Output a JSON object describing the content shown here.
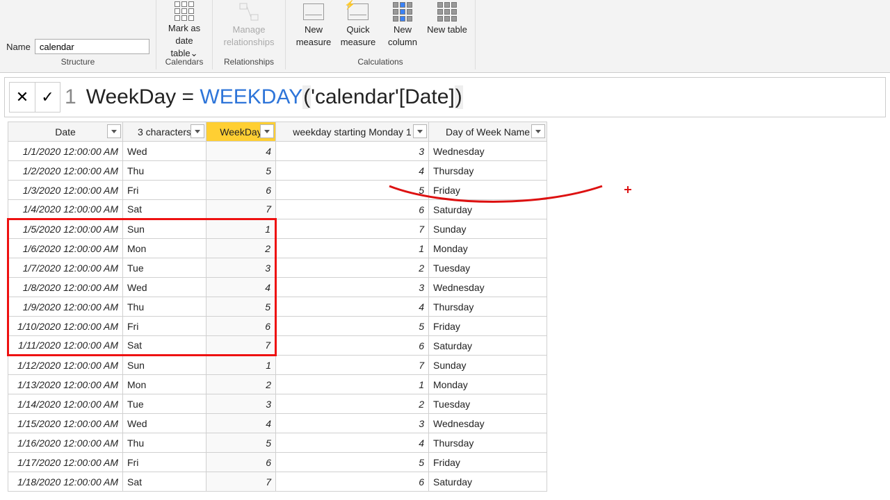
{
  "name_label": "Name",
  "table_name": "calendar",
  "ribbon": {
    "groups": {
      "structure": "Structure",
      "calendars": "Calendars",
      "relationships": "Relationships",
      "calculations": "Calculations"
    },
    "mark_date": "Mark as date table",
    "chev": "⌄",
    "manage_rel": "Manage relationships",
    "new_measure": "New measure",
    "quick_measure": "Quick measure",
    "new_column": "New column",
    "new_table": "New table"
  },
  "formula": {
    "line": "1",
    "lhs": "WeekDay",
    "eq": "=",
    "fn": "WEEKDAY",
    "open": "(",
    "arg": "'calendar'[Date]",
    "close": ")"
  },
  "fx": {
    "cancel": "✕",
    "accept": "✓"
  },
  "headers": {
    "date": "Date",
    "three": "3 characters",
    "weekday": "WeekDay",
    "wsm": "weekday starting Monday 1",
    "down": "Day of Week Name"
  },
  "rows": [
    {
      "date": "1/1/2020 12:00:00 AM",
      "t": "Wed",
      "wd": "4",
      "wsm": "3",
      "down": "Wednesday",
      "hl": ""
    },
    {
      "date": "1/2/2020 12:00:00 AM",
      "t": "Thu",
      "wd": "5",
      "wsm": "4",
      "down": "Thursday",
      "hl": ""
    },
    {
      "date": "1/3/2020 12:00:00 AM",
      "t": "Fri",
      "wd": "6",
      "wsm": "5",
      "down": "Friday",
      "hl": ""
    },
    {
      "date": "1/4/2020 12:00:00 AM",
      "t": "Sat",
      "wd": "7",
      "wsm": "6",
      "down": "Saturday",
      "hl": ""
    },
    {
      "date": "1/5/2020 12:00:00 AM",
      "t": "Sun",
      "wd": "1",
      "wsm": "7",
      "down": "Sunday",
      "hl": "top"
    },
    {
      "date": "1/6/2020 12:00:00 AM",
      "t": "Mon",
      "wd": "2",
      "wsm": "1",
      "down": "Monday",
      "hl": "mid"
    },
    {
      "date": "1/7/2020 12:00:00 AM",
      "t": "Tue",
      "wd": "3",
      "wsm": "2",
      "down": "Tuesday",
      "hl": "mid"
    },
    {
      "date": "1/8/2020 12:00:00 AM",
      "t": "Wed",
      "wd": "4",
      "wsm": "3",
      "down": "Wednesday",
      "hl": "mid"
    },
    {
      "date": "1/9/2020 12:00:00 AM",
      "t": "Thu",
      "wd": "5",
      "wsm": "4",
      "down": "Thursday",
      "hl": "mid"
    },
    {
      "date": "1/10/2020 12:00:00 AM",
      "t": "Fri",
      "wd": "6",
      "wsm": "5",
      "down": "Friday",
      "hl": "mid"
    },
    {
      "date": "1/11/2020 12:00:00 AM",
      "t": "Sat",
      "wd": "7",
      "wsm": "6",
      "down": "Saturday",
      "hl": "bot"
    },
    {
      "date": "1/12/2020 12:00:00 AM",
      "t": "Sun",
      "wd": "1",
      "wsm": "7",
      "down": "Sunday",
      "hl": ""
    },
    {
      "date": "1/13/2020 12:00:00 AM",
      "t": "Mon",
      "wd": "2",
      "wsm": "1",
      "down": "Monday",
      "hl": ""
    },
    {
      "date": "1/14/2020 12:00:00 AM",
      "t": "Tue",
      "wd": "3",
      "wsm": "2",
      "down": "Tuesday",
      "hl": ""
    },
    {
      "date": "1/15/2020 12:00:00 AM",
      "t": "Wed",
      "wd": "4",
      "wsm": "3",
      "down": "Wednesday",
      "hl": ""
    },
    {
      "date": "1/16/2020 12:00:00 AM",
      "t": "Thu",
      "wd": "5",
      "wsm": "4",
      "down": "Thursday",
      "hl": ""
    },
    {
      "date": "1/17/2020 12:00:00 AM",
      "t": "Fri",
      "wd": "6",
      "wsm": "5",
      "down": "Friday",
      "hl": ""
    },
    {
      "date": "1/18/2020 12:00:00 AM",
      "t": "Sat",
      "wd": "7",
      "wsm": "6",
      "down": "Saturday",
      "hl": ""
    }
  ]
}
